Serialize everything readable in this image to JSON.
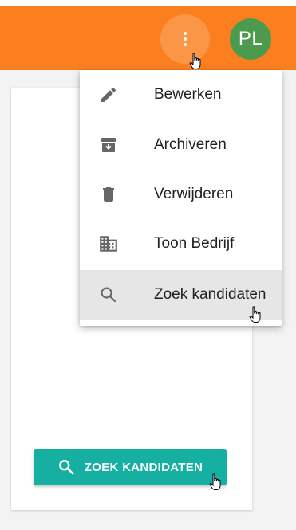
{
  "app_bar": {
    "color": "#fc7f1f",
    "more_icon": "more-vert-icon",
    "avatar_initials": "PL",
    "avatar_color": "#4c9a4e"
  },
  "menu": {
    "items": [
      {
        "label": "Bewerken",
        "icon": "pencil-icon"
      },
      {
        "label": "Archiveren",
        "icon": "archive-icon"
      },
      {
        "label": "Verwijderen",
        "icon": "trash-icon"
      },
      {
        "label": "Toon Bedrijf",
        "icon": "building-icon"
      },
      {
        "label": "Zoek kandidaten",
        "icon": "search-icon",
        "highlighted": true
      }
    ]
  },
  "card": {
    "search_button_label": "ZOEK KANDIDATEN",
    "search_button_color": "#15b0a2"
  }
}
